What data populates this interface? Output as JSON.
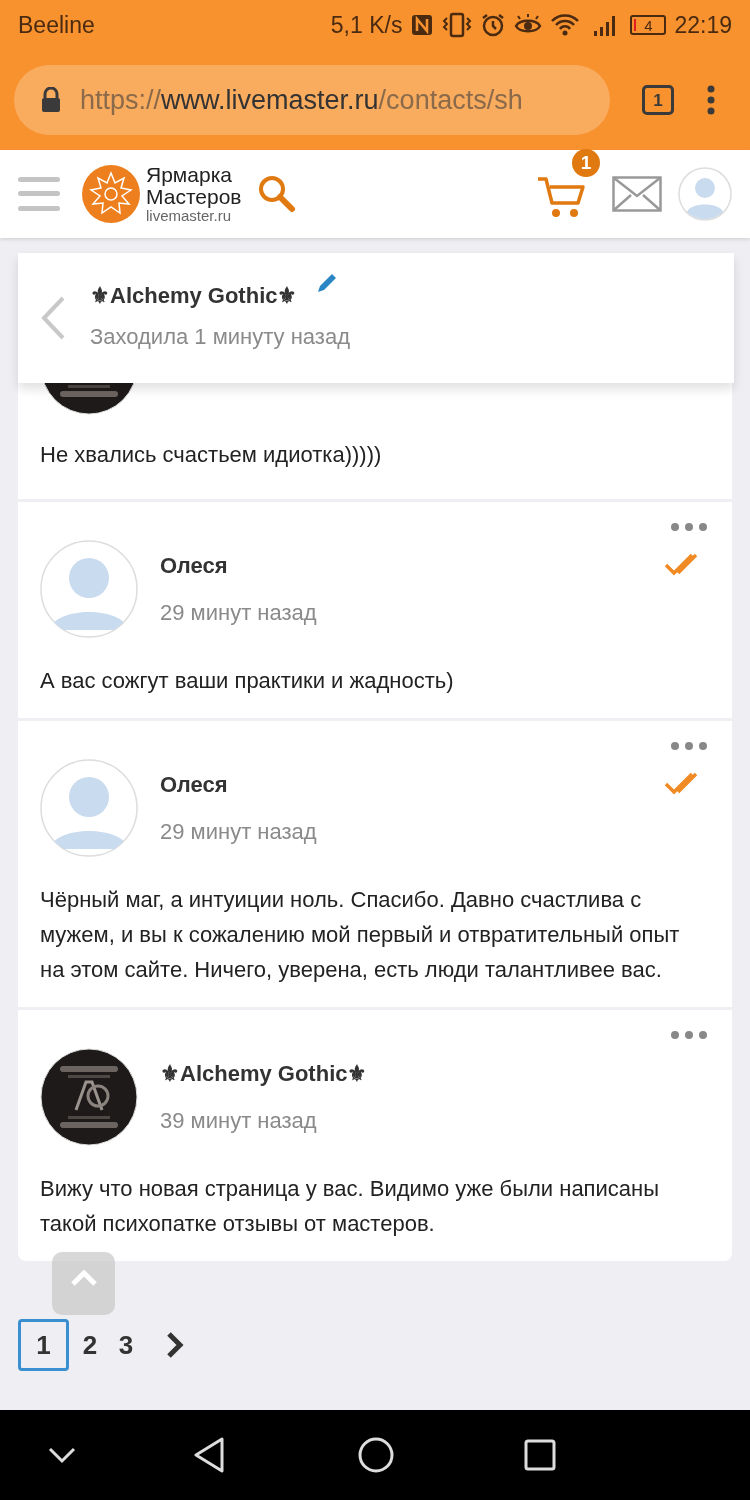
{
  "status_bar": {
    "carrier": "Beeline",
    "speed": "5,1 K/s",
    "battery": "4",
    "time": "22:19"
  },
  "browser": {
    "url_scheme": "https://",
    "url_host": "www.livemaster.ru",
    "url_path": "/contacts/sh",
    "tab_count": "1"
  },
  "site_header": {
    "logo_line_1": "Ярмарка",
    "logo_line_2": "Мастеров",
    "logo_domain": "livemaster.ru",
    "cart_count": "1"
  },
  "chat_header": {
    "name": "⚜Alchemy Gothic⚜",
    "last_seen": "Заходила 1 минуту назад"
  },
  "comments": [
    {
      "kind": "partial",
      "has_photo": true,
      "text": "Не хвались счастьем идиотка)))))"
    },
    {
      "kind": "full",
      "has_photo": false,
      "author": "Олеся",
      "time": "29 минут назад",
      "read": true,
      "text": "А вас сожгут ваши практики и жадность)"
    },
    {
      "kind": "full",
      "has_photo": false,
      "author": "Олеся",
      "time": "29 минут назад",
      "read": true,
      "text": "Чёрный маг, а интуиции ноль. Спасибо. Давно счастлива с мужем, и вы к сожалению мой первый и отвратительный опыт на этом сайте. Ничего, уверена, есть люди талантливее вас."
    },
    {
      "kind": "full",
      "has_photo": true,
      "author": "⚜Alchemy Gothic⚜",
      "time": "39 минут назад",
      "read": false,
      "text": "Вижу что новая страница у вас. Видимо уже были написаны такой психопатке отзывы от мастеров."
    }
  ],
  "pagination": [
    {
      "label": "1",
      "selected": true
    },
    {
      "label": "2",
      "selected": false
    },
    {
      "label": "3",
      "selected": false
    }
  ]
}
